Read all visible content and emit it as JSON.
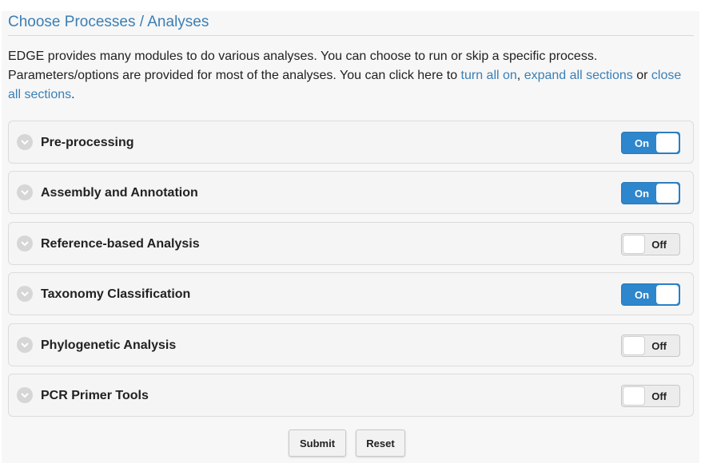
{
  "header": {
    "title": "Choose Processes / Analyses"
  },
  "intro": {
    "text1": "EDGE provides many modules to do various analyses. You can choose to run or skip a specific process. Parameters/options are provided for most of the analyses. You can click here to ",
    "link_turn_all_on": "turn all on",
    "sep": ", ",
    "link_expand_all": "expand all sections",
    "text_or": " or ",
    "link_close_all": "close all sections",
    "period": "."
  },
  "sections": [
    {
      "label": "Pre-processing",
      "state": "On"
    },
    {
      "label": "Assembly and Annotation",
      "state": "On"
    },
    {
      "label": "Reference-based Analysis",
      "state": "Off"
    },
    {
      "label": "Taxonomy Classification",
      "state": "On"
    },
    {
      "label": "Phylogenetic Analysis",
      "state": "Off"
    },
    {
      "label": "PCR Primer Tools",
      "state": "Off"
    }
  ],
  "buttons": {
    "submit": "Submit",
    "reset": "Reset"
  },
  "colors": {
    "accent": "#3a7fb5",
    "toggle_on": "#2e86cc"
  }
}
